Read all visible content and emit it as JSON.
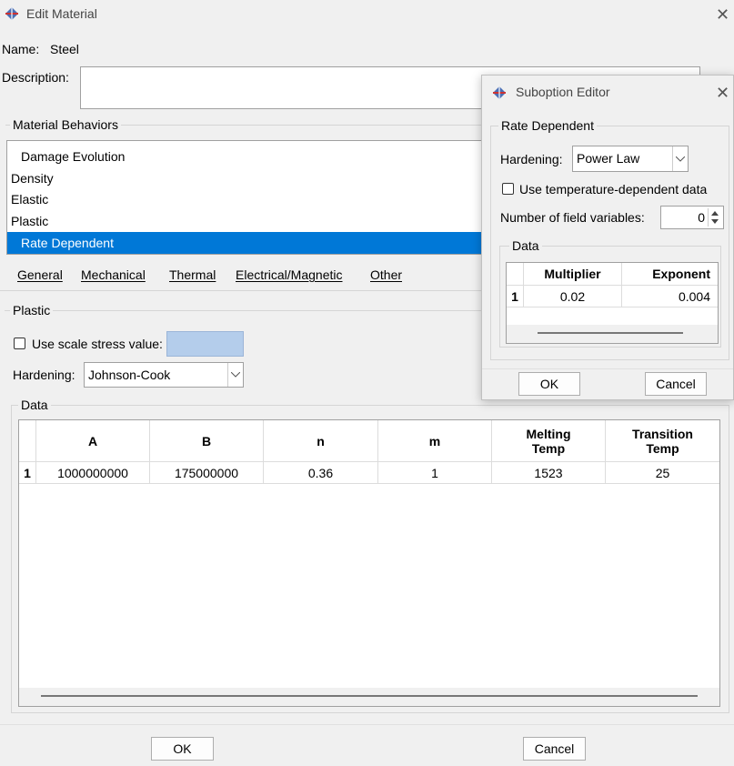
{
  "window": {
    "title": "Edit Material",
    "icon": "app-diamond-icon"
  },
  "name_row": {
    "label": "Name:",
    "value": "Steel"
  },
  "description": {
    "label": "Description:",
    "value": ""
  },
  "behaviors": {
    "title": "Material Behaviors",
    "items": [
      {
        "label": "Damage Evolution",
        "indent": true,
        "selected": false
      },
      {
        "label": "Density",
        "indent": false,
        "selected": false
      },
      {
        "label": "Elastic",
        "indent": false,
        "selected": false
      },
      {
        "label": "Plastic",
        "indent": false,
        "selected": false
      },
      {
        "label": "Rate Dependent",
        "indent": true,
        "selected": true
      }
    ],
    "menus": [
      "General",
      "Mechanical",
      "Thermal",
      "Electrical/Magnetic",
      "Other"
    ]
  },
  "plastic": {
    "title": "Plastic",
    "scale_stress_label": "Use scale stress value:",
    "scale_stress_checked": false,
    "hardening_label": "Hardening:",
    "hardening_value": "Johnson-Cook",
    "data_title": "Data",
    "columns": [
      "A",
      "B",
      "n",
      "m",
      "Melting Temp",
      "Transition Temp"
    ],
    "rows": [
      {
        "index": "1",
        "cells": [
          "1000000000",
          "175000000",
          "0.36",
          "1",
          "1523",
          "25"
        ]
      }
    ]
  },
  "buttons": {
    "ok": "OK",
    "cancel": "Cancel"
  },
  "suboption": {
    "title": "Suboption Editor",
    "group_title": "Rate Dependent",
    "hardening_label": "Hardening:",
    "hardening_value": "Power Law",
    "temp_dep_label": "Use temperature-dependent data",
    "temp_dep_checked": false,
    "field_vars_label": "Number of field variables:",
    "field_vars_value": "0",
    "data_title": "Data",
    "columns": [
      "Multiplier",
      "Exponent"
    ],
    "rows": [
      {
        "index": "1",
        "cells": [
          "0.02",
          "0.004"
        ]
      }
    ],
    "ok": "OK",
    "cancel": "Cancel"
  },
  "colors": {
    "selection": "#0078d7",
    "scale_field": "#b4cdeb",
    "background": "#f0f0f0"
  }
}
